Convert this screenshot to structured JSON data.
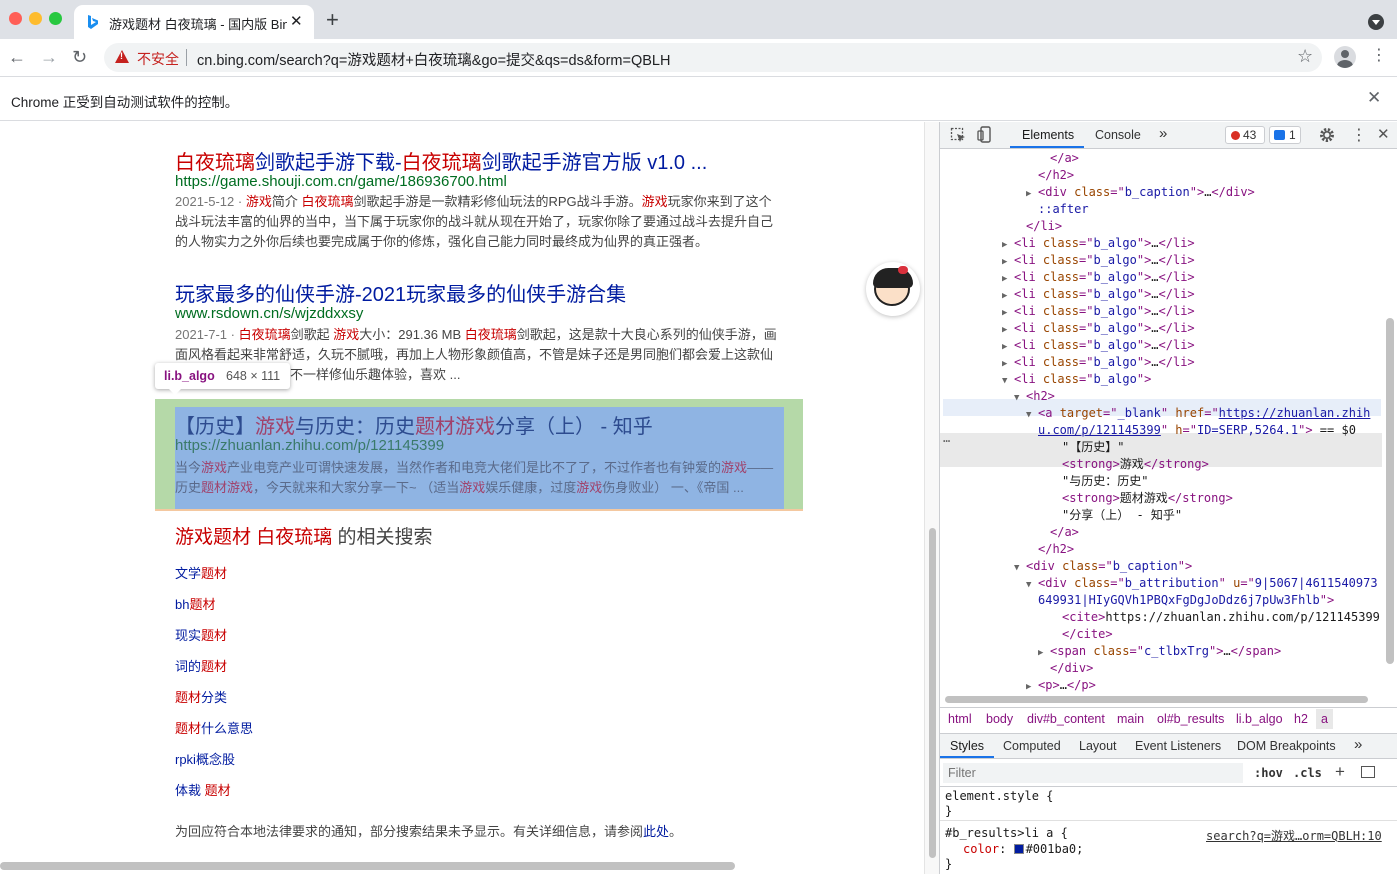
{
  "browser": {
    "tab_title": "游戏题材 白夜琉璃 - 国内版 Bing",
    "new_tab_glyph": "+",
    "insecure_label": "不安全",
    "url": "cn.bing.com/search?q=游戏题材+白夜琉璃&go=提交&qs=ds&form=QBLH",
    "infobar_text": "Chrome 正受到自动测试软件的控制。"
  },
  "results": [
    {
      "title_parts": [
        "白夜琉璃",
        "剑歌起手游下载-",
        "白夜琉璃",
        "剑歌起手游官方版 v1.0 ..."
      ],
      "url": "https://game.shouji.com.cn/game/186936700.html",
      "snippet_lines": [
        [
          "2021-5-12 · ",
          "游戏",
          "简介 ",
          "白夜琉璃",
          "剑歌起手游是一款精彩修仙玩法的RPG战斗手游。",
          "游戏",
          "玩家你来到了这个"
        ],
        [
          "战斗玩法丰富的仙界的当中，当下属于玩家你的战斗就从现在开始了，玩家你除了要通过战斗去提升自己"
        ],
        [
          "的人物实力之外你后续也要完成属于你的修炼，强化自己能力同时最终成为仙界的真正强者。"
        ]
      ]
    },
    {
      "title": "玩家最多的仙侠手游-2021玩家最多的仙侠手游合集",
      "url": "www.rsdown.cn/s/wjzddxxsy",
      "snippet_lines": [
        [
          "2021-7-1 · ",
          "白夜琉璃",
          "剑歌起 ",
          "游戏",
          "大小：291.36 MB ",
          "白夜琉璃",
          "剑歌起，这是款十大良心系列的仙侠手游，画"
        ],
        [
          "面风格看起来非常舒适，久玩不腻哦，再加上人物形象颜值高，不管是妹子还是男同胞们都会爱上这款仙"
        ],
        [
          "不一样修仙乐趣体验，喜欢 ..."
        ]
      ]
    },
    {
      "title_parts": [
        "【历史】",
        "游戏",
        "与历史：历史",
        "题材游戏",
        "分享（上） - 知乎"
      ],
      "url": "https://zhuanlan.zhihu.com/p/121145399",
      "snippet_lines": [
        [
          "当今",
          "游戏",
          "产业电竞产业可谓快速发展，当然作者和电竞大佬们是比不了了，不过作者也有钟爱的",
          "游戏",
          "——"
        ],
        [
          "历史",
          "题材游戏",
          "，今天就来和大家分享一下~ （适当",
          "游戏",
          "娱乐健康，过度",
          "游戏",
          "伤身败业） 一、《帝国 ..."
        ]
      ]
    }
  ],
  "inspect_tooltip": {
    "tag": "li.b_algo",
    "size": "648 × 111"
  },
  "related": {
    "title_parts": [
      "游戏题材 白夜琉璃",
      " 的相关搜索"
    ],
    "items": [
      [
        "文学",
        "题材"
      ],
      [
        "bh",
        "题材"
      ],
      [
        "现实",
        "题材"
      ],
      [
        "词的",
        "题材"
      ],
      [
        "",
        "题材",
        "分类"
      ],
      [
        "",
        "题材",
        "什么意思"
      ],
      [
        "rpki概念股"
      ],
      [
        "体裁 ",
        "题材"
      ]
    ]
  },
  "notice": {
    "text": "为回应符合本地法律要求的通知，部分搜索结果未予显示。有关详细信息，请参阅",
    "link": "此处",
    "end": "。"
  },
  "devtools": {
    "tabs": [
      "Elements",
      "Console",
      "»"
    ],
    "error_count": "43",
    "message_count": "1",
    "dom_lines": [
      {
        "indent": 8,
        "text": "</a>"
      },
      {
        "indent": 7,
        "text": "</h2>"
      },
      {
        "indent": 7,
        "tri": "▶",
        "parts": [
          [
            "tg",
            "<div "
          ],
          [
            "an",
            "class"
          ],
          [
            "tg",
            "=\""
          ],
          [
            "av",
            "b_caption"
          ],
          [
            "tg",
            "\">"
          ],
          [
            "tx",
            "…"
          ],
          [
            "tg",
            "</div>"
          ]
        ]
      },
      {
        "indent": 7,
        "text": "::after",
        "cls": "av"
      },
      {
        "indent": 6,
        "text": "</li>"
      },
      {
        "indent": 5,
        "tri": "▶",
        "parts": [
          [
            "tg",
            "<li "
          ],
          [
            "an",
            "class"
          ],
          [
            "tg",
            "=\""
          ],
          [
            "av",
            "b_algo"
          ],
          [
            "tg",
            "\">"
          ],
          [
            "tx",
            "…"
          ],
          [
            "tg",
            "</li>"
          ]
        ]
      },
      {
        "indent": 5,
        "tri": "▶",
        "parts": [
          [
            "tg",
            "<li "
          ],
          [
            "an",
            "class"
          ],
          [
            "tg",
            "=\""
          ],
          [
            "av",
            "b_algo"
          ],
          [
            "tg",
            "\">"
          ],
          [
            "tx",
            "…"
          ],
          [
            "tg",
            "</li>"
          ]
        ]
      },
      {
        "indent": 5,
        "tri": "▶",
        "parts": [
          [
            "tg",
            "<li "
          ],
          [
            "an",
            "class"
          ],
          [
            "tg",
            "=\""
          ],
          [
            "av",
            "b_algo"
          ],
          [
            "tg",
            "\">"
          ],
          [
            "tx",
            "…"
          ],
          [
            "tg",
            "</li>"
          ]
        ]
      },
      {
        "indent": 5,
        "tri": "▶",
        "parts": [
          [
            "tg",
            "<li "
          ],
          [
            "an",
            "class"
          ],
          [
            "tg",
            "=\""
          ],
          [
            "av",
            "b_algo"
          ],
          [
            "tg",
            "\">"
          ],
          [
            "tx",
            "…"
          ],
          [
            "tg",
            "</li>"
          ]
        ]
      },
      {
        "indent": 5,
        "tri": "▶",
        "parts": [
          [
            "tg",
            "<li "
          ],
          [
            "an",
            "class"
          ],
          [
            "tg",
            "=\""
          ],
          [
            "av",
            "b_algo"
          ],
          [
            "tg",
            "\">"
          ],
          [
            "tx",
            "…"
          ],
          [
            "tg",
            "</li>"
          ]
        ]
      },
      {
        "indent": 5,
        "tri": "▶",
        "parts": [
          [
            "tg",
            "<li "
          ],
          [
            "an",
            "class"
          ],
          [
            "tg",
            "=\""
          ],
          [
            "av",
            "b_algo"
          ],
          [
            "tg",
            "\">"
          ],
          [
            "tx",
            "…"
          ],
          [
            "tg",
            "</li>"
          ]
        ]
      },
      {
        "indent": 5,
        "tri": "▶",
        "parts": [
          [
            "tg",
            "<li "
          ],
          [
            "an",
            "class"
          ],
          [
            "tg",
            "=\""
          ],
          [
            "av",
            "b_algo"
          ],
          [
            "tg",
            "\">"
          ],
          [
            "tx",
            "…"
          ],
          [
            "tg",
            "</li>"
          ]
        ]
      },
      {
        "indent": 5,
        "tri": "▶",
        "parts": [
          [
            "tg",
            "<li "
          ],
          [
            "an",
            "class"
          ],
          [
            "tg",
            "=\""
          ],
          [
            "av",
            "b_algo"
          ],
          [
            "tg",
            "\">"
          ],
          [
            "tx",
            "…"
          ],
          [
            "tg",
            "</li>"
          ]
        ]
      },
      {
        "indent": 5,
        "tri": "▼",
        "parts": [
          [
            "tg",
            "<li "
          ],
          [
            "an",
            "class"
          ],
          [
            "tg",
            "=\""
          ],
          [
            "av",
            "b_algo"
          ],
          [
            "tg",
            "\">"
          ]
        ]
      },
      {
        "indent": 6,
        "tri": "▼",
        "parts": [
          [
            "tg",
            "<h2>"
          ]
        ]
      },
      {
        "indent": 7,
        "tri": "▼",
        "parts": [
          [
            "tg",
            "<a "
          ],
          [
            "an",
            "target"
          ],
          [
            "tg",
            "=\""
          ],
          [
            "av",
            "_blank"
          ],
          [
            "tg",
            "\" "
          ],
          [
            "an",
            "href"
          ],
          [
            "tg",
            "=\""
          ],
          [
            "lnk",
            "https://zhuanlan.zhih"
          ]
        ]
      },
      {
        "indent": 7,
        "parts": [
          [
            "lnk",
            "u.com/p/121145399"
          ],
          [
            "tg",
            "\" "
          ],
          [
            "an",
            "h"
          ],
          [
            "tg",
            "=\""
          ],
          [
            "av",
            "ID=SERP,5264.1"
          ],
          [
            "tg",
            "\">"
          ],
          [
            "tx",
            " == $0"
          ]
        ]
      },
      {
        "indent": 9,
        "parts": [
          [
            "tx",
            "\"【历史】\""
          ]
        ]
      },
      {
        "indent": 9,
        "parts": [
          [
            "tg",
            "<strong>"
          ],
          [
            "tx",
            "游戏"
          ],
          [
            "tg",
            "</strong>"
          ]
        ]
      },
      {
        "indent": 9,
        "parts": [
          [
            "tx",
            "\"与历史：历史\""
          ]
        ]
      },
      {
        "indent": 9,
        "parts": [
          [
            "tg",
            "<strong>"
          ],
          [
            "tx",
            "题材游戏"
          ],
          [
            "tg",
            "</strong>"
          ]
        ]
      },
      {
        "indent": 9,
        "parts": [
          [
            "tx",
            "\"分享（上） - 知乎\""
          ]
        ]
      },
      {
        "indent": 8,
        "text": "</a>"
      },
      {
        "indent": 7,
        "text": "</h2>"
      },
      {
        "indent": 6,
        "tri": "▼",
        "parts": [
          [
            "tg",
            "<div "
          ],
          [
            "an",
            "class"
          ],
          [
            "tg",
            "=\""
          ],
          [
            "av",
            "b_caption"
          ],
          [
            "tg",
            "\">"
          ]
        ]
      },
      {
        "indent": 7,
        "tri": "▼",
        "parts": [
          [
            "tg",
            "<div "
          ],
          [
            "an",
            "class"
          ],
          [
            "tg",
            "=\""
          ],
          [
            "av",
            "b_attribution"
          ],
          [
            "tg",
            "\" "
          ],
          [
            "an",
            "u"
          ],
          [
            "tg",
            "=\""
          ],
          [
            "av",
            "9|5067|4611540973"
          ]
        ]
      },
      {
        "indent": 7,
        "parts": [
          [
            "av",
            "649931|HIyGQVh1PBQxFgDgJoDdz6j7pUw3Fhlb"
          ],
          [
            "tg",
            "\">"
          ]
        ]
      },
      {
        "indent": 9,
        "parts": [
          [
            "tg",
            "<cite>"
          ],
          [
            "tx",
            "https://zhuanlan.zhihu.com/p/121145399"
          ]
        ]
      },
      {
        "indent": 9,
        "text": "</cite>"
      },
      {
        "indent": 8,
        "tri": "▶",
        "parts": [
          [
            "tg",
            "<span "
          ],
          [
            "an",
            "class"
          ],
          [
            "tg",
            "=\""
          ],
          [
            "av",
            "c_tlbxTrg"
          ],
          [
            "tg",
            "\">"
          ],
          [
            "tx",
            "…"
          ],
          [
            "tg",
            "</span>"
          ]
        ]
      },
      {
        "indent": 8,
        "text": "</div>"
      },
      {
        "indent": 7,
        "tri": "▶",
        "parts": [
          [
            "tg",
            "<p>"
          ],
          [
            "tx",
            "…"
          ],
          [
            "tg",
            "</p>"
          ]
        ]
      }
    ],
    "breadcrumbs": [
      "html",
      "body",
      "div#b_content",
      "main",
      "ol#b_results",
      "li.b_algo",
      "h2",
      "a"
    ],
    "style_tabs": [
      "Styles",
      "Computed",
      "Layout",
      "Event Listeners",
      "DOM Breakpoints",
      "»"
    ],
    "filter_placeholder": "Filter",
    "hov": ":hov",
    "cls": ".cls",
    "element_style_open": "element.style {",
    "close_brace": "}",
    "rule_selector": "#b_results>li a {",
    "rule_source": "search?q=游戏…orm=QBLH:10",
    "rule_prop": "color",
    "rule_value": "#001ba0;",
    "link_color": "#001ba0"
  }
}
